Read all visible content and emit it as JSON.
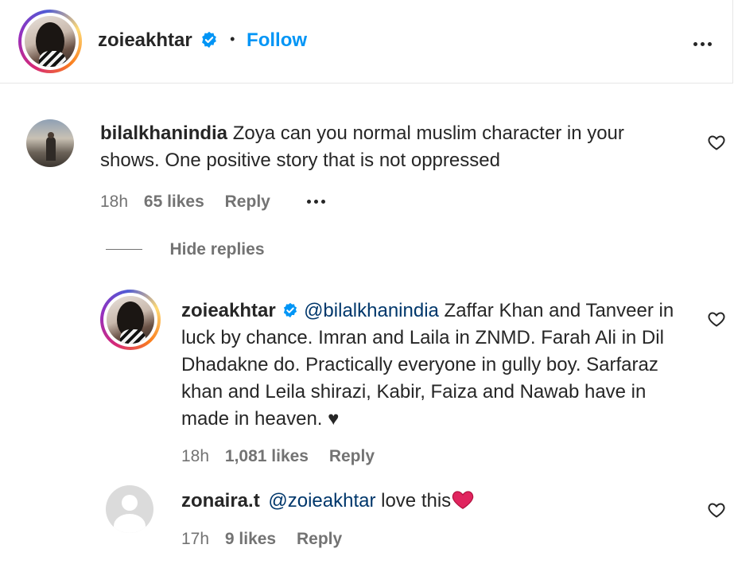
{
  "header": {
    "username": "zoieakhtar",
    "separator": "•",
    "follow_label": "Follow",
    "more_icon": "more-horizontal-icon"
  },
  "comments": [
    {
      "username": "bilalkhanindia",
      "text": "Zoya can you normal muslim character in your shows. One positive story that is not oppressed",
      "time": "18h",
      "likes": "65 likes",
      "reply_label": "Reply"
    }
  ],
  "replies_toggle": {
    "label": "Hide replies"
  },
  "replies": [
    {
      "username": "zoieakhtar",
      "mention": "@bilalkhanindia",
      "text": " Zaffar Khan and Tanveer in luck by chance. Imran and Laila in ZNMD. Farah Ali in Dil Dhadakne do. Practically everyone in gully boy. Sarfaraz khan and Leila shirazi, Kabir, Faiza and Nawab have in made in heaven. ♥",
      "time": "18h",
      "likes": "1,081 likes",
      "reply_label": "Reply"
    },
    {
      "username": "zonaira.t",
      "mention": "@zoieakhtar",
      "text": " love this",
      "emoji": "❤️",
      "time": "17h",
      "likes": "9 likes",
      "reply_label": "Reply"
    }
  ],
  "colors": {
    "link": "#0095f6",
    "mention": "#00376b",
    "muted": "#737373",
    "verified": "#0095f6",
    "heart_emoji": "#e0245e"
  }
}
